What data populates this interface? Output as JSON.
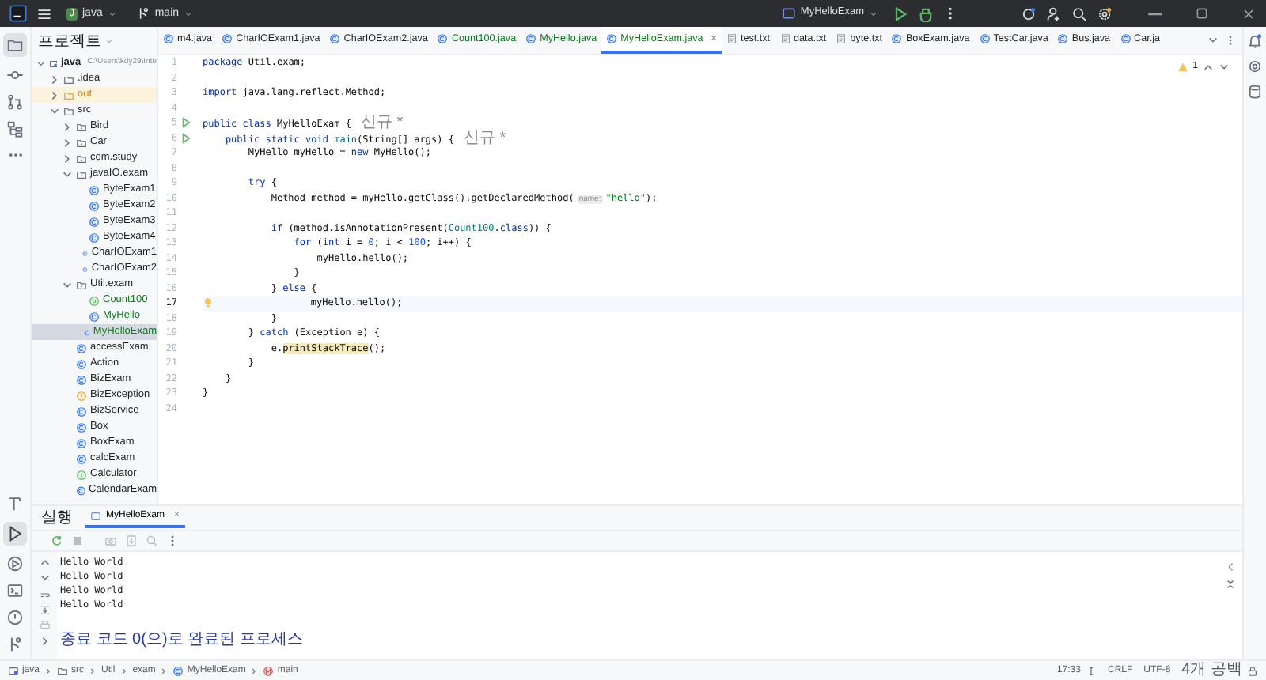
{
  "title_bar": {
    "project": {
      "badge": "J",
      "name": "java"
    },
    "branch": "main",
    "run_config": "MyHelloExam"
  },
  "project_panel": {
    "title": "프로젝트",
    "tree": [
      {
        "label": "java",
        "path": "C:\\Users\\kdy29\\Inte",
        "kind": "module",
        "expanded": true,
        "selected": false,
        "color": "#1e1f22",
        "children": [
          {
            "label": ".idea",
            "kind": "folder",
            "expanded": false,
            "selected": false,
            "color": "#1e1f22"
          },
          {
            "label": "out",
            "kind": "excluded",
            "expanded": false,
            "selected": false,
            "color": "#d08a00"
          },
          {
            "label": "src",
            "kind": "folder",
            "expanded": true,
            "selected": false,
            "color": "#1e1f22",
            "children": [
              {
                "label": "Bird",
                "kind": "package",
                "expanded": false,
                "selected": false,
                "color": "#1e1f22"
              },
              {
                "label": "Car",
                "kind": "package",
                "expanded": false,
                "selected": false,
                "color": "#1e1f22"
              },
              {
                "label": "com.study",
                "kind": "package",
                "expanded": false,
                "selected": false,
                "color": "#1e1f22"
              },
              {
                "label": "javaIO.exam",
                "kind": "package",
                "expanded": true,
                "selected": false,
                "color": "#1e1f22",
                "children": [
                  {
                    "label": "ByteExam1",
                    "kind": "class",
                    "selected": false,
                    "color": "#1e1f22"
                  },
                  {
                    "label": "ByteExam2",
                    "kind": "class",
                    "selected": false,
                    "color": "#1e1f22"
                  },
                  {
                    "label": "ByteExam3",
                    "kind": "class",
                    "selected": false,
                    "color": "#1e1f22"
                  },
                  {
                    "label": "ByteExam4",
                    "kind": "class",
                    "selected": false,
                    "color": "#1e1f22"
                  },
                  {
                    "label": "CharIOExam1",
                    "kind": "class",
                    "selected": false,
                    "color": "#1e1f22"
                  },
                  {
                    "label": "CharIOExam2",
                    "kind": "class",
                    "selected": false,
                    "color": "#1e1f22"
                  }
                ]
              },
              {
                "label": "Util.exam",
                "kind": "package",
                "expanded": true,
                "selected": false,
                "color": "#1e1f22",
                "children": [
                  {
                    "label": "Count100",
                    "kind": "annotation",
                    "selected": false,
                    "color": "#067d17"
                  },
                  {
                    "label": "MyHello",
                    "kind": "class",
                    "selected": false,
                    "color": "#067d17"
                  },
                  {
                    "label": "MyHelloExam",
                    "kind": "class",
                    "selected": true,
                    "color": "#067d17"
                  }
                ]
              },
              {
                "label": "accessExam",
                "kind": "class",
                "selected": false,
                "color": "#1e1f22"
              },
              {
                "label": "Action",
                "kind": "class",
                "selected": false,
                "color": "#1e1f22"
              },
              {
                "label": "BizExam",
                "kind": "class",
                "selected": false,
                "color": "#1e1f22"
              },
              {
                "label": "BizException",
                "kind": "exception",
                "selected": false,
                "color": "#1e1f22"
              },
              {
                "label": "BizService",
                "kind": "class",
                "selected": false,
                "color": "#1e1f22"
              },
              {
                "label": "Box",
                "kind": "class",
                "selected": false,
                "color": "#1e1f22"
              },
              {
                "label": "BoxExam",
                "kind": "class",
                "selected": false,
                "color": "#1e1f22"
              },
              {
                "label": "calcExam",
                "kind": "class",
                "selected": false,
                "color": "#1e1f22"
              },
              {
                "label": "Calculator",
                "kind": "interface",
                "selected": false,
                "color": "#1e1f22"
              },
              {
                "label": "CalendarExam",
                "kind": "class",
                "selected": false,
                "color": "#1e1f22"
              }
            ]
          }
        ]
      }
    ]
  },
  "editor_tabs": [
    {
      "label": "m4.java",
      "kind": "java",
      "selected": false,
      "color": "#1e1f22"
    },
    {
      "label": "CharIOExam1.java",
      "kind": "java",
      "selected": false,
      "color": "#1e1f22"
    },
    {
      "label": "CharIOExam2.java",
      "kind": "java",
      "selected": false,
      "color": "#1e1f22"
    },
    {
      "label": "Count100.java",
      "kind": "java",
      "selected": false,
      "color": "#067d17"
    },
    {
      "label": "MyHello.java",
      "kind": "java",
      "selected": false,
      "color": "#067d17"
    },
    {
      "label": "MyHelloExam.java",
      "kind": "java",
      "selected": true,
      "color": "#067d17",
      "close": "×"
    },
    {
      "label": "test.txt",
      "kind": "text",
      "selected": false,
      "color": "#1e1f22"
    },
    {
      "label": "data.txt",
      "kind": "text",
      "selected": false,
      "color": "#1e1f22"
    },
    {
      "label": "byte.txt",
      "kind": "text",
      "selected": false,
      "color": "#1e1f22"
    },
    {
      "label": "BoxExam.java",
      "kind": "java",
      "selected": false,
      "color": "#1e1f22"
    },
    {
      "label": "TestCar.java",
      "kind": "java",
      "selected": false,
      "color": "#1e1f22"
    },
    {
      "label": "Bus.java",
      "kind": "java",
      "selected": false,
      "color": "#1e1f22"
    },
    {
      "label": "Car.ja",
      "kind": "java",
      "selected": false,
      "color": "#1e1f22"
    }
  ],
  "inspections": {
    "warnings": "1"
  },
  "code": [
    {
      "number": "1",
      "kind": "plain",
      "current": false,
      "tokens": [
        {
          "kind": "kw",
          "text": "package"
        },
        {
          "kind": "plain",
          "text": " Util.exam;"
        }
      ]
    },
    {
      "number": "2",
      "kind": "plain",
      "current": false
    },
    {
      "number": "3",
      "kind": "plain",
      "current": false,
      "tokens": [
        {
          "kind": "kw",
          "text": "import"
        },
        {
          "kind": "plain",
          "text": " java.lang.reflect.Method;"
        }
      ]
    },
    {
      "number": "4",
      "kind": "plain",
      "current": false
    },
    {
      "number": "5",
      "kind": "runnable",
      "current": false,
      "tokens": [
        {
          "kind": "kw",
          "text": "public class"
        },
        {
          "kind": "plain",
          "text": " MyHelloExam {"
        },
        {
          "kind": "author",
          "text": "신규 *"
        }
      ]
    },
    {
      "number": "6",
      "kind": "runnable",
      "current": false,
      "tokens": [
        {
          "kind": "kw",
          "text": "    public static void"
        },
        {
          "kind": "fn",
          "text": " main"
        },
        {
          "kind": "plain",
          "text": "(String[] args) {"
        },
        {
          "kind": "author",
          "text": "신규 *"
        }
      ]
    },
    {
      "number": "7",
      "kind": "plain",
      "current": false,
      "tokens": [
        {
          "kind": "plain",
          "text": "        MyHello myHello = "
        },
        {
          "kind": "kw",
          "text": "new"
        },
        {
          "kind": "plain",
          "text": " MyHello();"
        }
      ]
    },
    {
      "number": "8",
      "kind": "plain",
      "current": false
    },
    {
      "number": "9",
      "kind": "plain",
      "current": false,
      "tokens": [
        {
          "kind": "kw",
          "text": "        try"
        },
        {
          "kind": "plain",
          "text": " {"
        }
      ]
    },
    {
      "number": "10",
      "kind": "plain",
      "current": false,
      "tokens": [
        {
          "kind": "plain",
          "text": "            Method method = myHello.getClass().getDeclaredMethod("
        },
        {
          "kind": "hint",
          "text": "name:"
        },
        {
          "kind": "str",
          "text": "\"hello\""
        },
        {
          "kind": "plain",
          "text": ");"
        }
      ]
    },
    {
      "number": "11",
      "kind": "plain",
      "current": false
    },
    {
      "number": "12",
      "kind": "plain",
      "current": false,
      "tokens": [
        {
          "kind": "kw",
          "text": "            if"
        },
        {
          "kind": "plain",
          "text": " (method.isAnnotationPresent("
        },
        {
          "kind": "type",
          "text": "Count100"
        },
        {
          "kind": "plain",
          "text": "."
        },
        {
          "kind": "kw",
          "text": "class"
        },
        {
          "kind": "plain",
          "text": ")) {"
        }
      ]
    },
    {
      "number": "13",
      "kind": "plain",
      "current": false,
      "tokens": [
        {
          "kind": "kw",
          "text": "                for"
        },
        {
          "kind": "plain",
          "text": " ("
        },
        {
          "kind": "kw",
          "text": "int"
        },
        {
          "kind": "plain",
          "text": " i = "
        },
        {
          "kind": "num",
          "text": "0"
        },
        {
          "kind": "plain",
          "text": "; i < "
        },
        {
          "kind": "num",
          "text": "100"
        },
        {
          "kind": "plain",
          "text": "; i++) {"
        }
      ]
    },
    {
      "number": "14",
      "kind": "plain",
      "current": false,
      "tokens": [
        {
          "kind": "plain",
          "text": "                    myHello.hello();"
        }
      ]
    },
    {
      "number": "15",
      "kind": "plain",
      "current": false,
      "tokens": [
        {
          "kind": "plain",
          "text": "                }"
        }
      ]
    },
    {
      "number": "16",
      "kind": "plain",
      "current": false,
      "tokens": [
        {
          "kind": "plain",
          "text": "            } "
        },
        {
          "kind": "kw",
          "text": "else"
        },
        {
          "kind": "plain",
          "text": " {"
        }
      ]
    },
    {
      "number": "17",
      "kind": "intention",
      "current": true,
      "tokens": [
        {
          "kind": "plain",
          "text": "                myHello.hello();"
        }
      ]
    },
    {
      "number": "18",
      "kind": "plain",
      "current": false,
      "tokens": [
        {
          "kind": "plain",
          "text": "            }"
        }
      ]
    },
    {
      "number": "19",
      "kind": "plain",
      "current": false,
      "tokens": [
        {
          "kind": "plain",
          "text": "        } "
        },
        {
          "kind": "kw",
          "text": "catch"
        },
        {
          "kind": "plain",
          "text": " (Exception e) {"
        }
      ]
    },
    {
      "number": "20",
      "kind": "plain",
      "current": false,
      "tokens": [
        {
          "kind": "plain",
          "text": "            e."
        },
        {
          "kind": "warn",
          "text": "printStackTrace"
        },
        {
          "kind": "plain",
          "text": "();"
        }
      ]
    },
    {
      "number": "21",
      "kind": "plain",
      "current": false,
      "tokens": [
        {
          "kind": "plain",
          "text": "        }"
        }
      ]
    },
    {
      "number": "22",
      "kind": "plain",
      "current": false,
      "tokens": [
        {
          "kind": "plain",
          "text": "    }"
        }
      ]
    },
    {
      "number": "23",
      "kind": "plain",
      "current": false,
      "tokens": [
        {
          "kind": "plain",
          "text": "}"
        }
      ]
    },
    {
      "number": "24",
      "kind": "plain",
      "current": false
    }
  ],
  "run_panel": {
    "title": "실행",
    "tabs": [
      {
        "label": "MyHelloExam",
        "selected": true,
        "close": "×"
      }
    ],
    "output": [
      {
        "kind": "stdout",
        "text": "Hello World"
      },
      {
        "kind": "stdout",
        "text": "Hello World"
      },
      {
        "kind": "stdout",
        "text": "Hello World"
      },
      {
        "kind": "stdout",
        "text": "Hello World"
      },
      {
        "kind": "blank"
      },
      {
        "kind": "system",
        "text": "종료 코드 0(으)로 완료된 프로세스"
      }
    ]
  },
  "status_bar": {
    "breadcrumbs": [
      {
        "kind": "module",
        "label": "java"
      },
      {
        "kind": "folder",
        "label": "src"
      },
      {
        "kind": "plain",
        "label": "Util"
      },
      {
        "kind": "plain",
        "label": "exam"
      },
      {
        "kind": "class",
        "label": "MyHelloExam"
      },
      {
        "kind": "method",
        "label": "main"
      }
    ],
    "position": "17:33",
    "line_separator": "CRLF",
    "encoding": "UTF-8",
    "indent": "4개 공백"
  }
}
